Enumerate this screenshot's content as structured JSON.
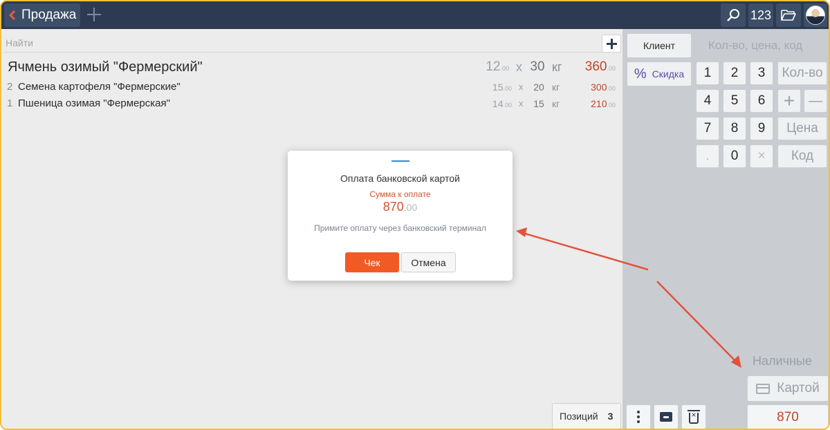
{
  "header": {
    "tab_title": "Продажа",
    "counter_label": "123",
    "icons": [
      "back-chevron-icon",
      "plus-icon",
      "search-icon",
      "folder-icon",
      "avatar"
    ]
  },
  "search": {
    "placeholder": "Найти"
  },
  "order": {
    "items": [
      {
        "index": "",
        "name": "Ячмень озимый \"Фермерский\"",
        "price_int": "12",
        "price_dec": ".00",
        "x": "x",
        "qty": "30",
        "unit": "кг",
        "sum_int": "360",
        "sum_dec": ".00"
      },
      {
        "index": "2",
        "name": "Семена картофеля \"Фермерские\"",
        "price_int": "15",
        "price_dec": ".00",
        "x": "x",
        "qty": "20",
        "unit": "кг",
        "sum_int": "300",
        "sum_dec": ".00"
      },
      {
        "index": "1",
        "name": "Пшеница озимая \"Фермерская\"",
        "price_int": "14",
        "price_dec": ".00",
        "x": "x",
        "qty": "15",
        "unit": "кг",
        "sum_int": "210",
        "sum_dec": ".00"
      }
    ],
    "positions_label": "Позиций",
    "positions_count": "3"
  },
  "panel": {
    "client_label": "Клиент",
    "discount_label": "Скидка",
    "discount_icon": "%",
    "input_hint": "Кол-во, цена, код",
    "keys": [
      "1",
      "2",
      "3",
      "4",
      "5",
      "6",
      "7",
      "8",
      "9",
      ".",
      "0",
      "×"
    ],
    "qty_label": "Кол-во",
    "price_label": "Цена",
    "code_label": "Код",
    "plus": "+",
    "minus": "—",
    "cash_label": "Наличные",
    "card_label": "Картой",
    "total": "870"
  },
  "modal": {
    "title": "Оплата банковской картой",
    "due_label": "Сумма к оплате",
    "due_int": "870",
    "due_dec": ".00",
    "instruction": "Примите оплату через банковский терминал",
    "ok_label": "Чек",
    "cancel_label": "Отмена"
  },
  "colors": {
    "topbar": "#2c3b52",
    "accent": "#f15a24",
    "sum": "#c0452b",
    "frame": "#f2bf3a",
    "annotation": "#e2523a"
  }
}
